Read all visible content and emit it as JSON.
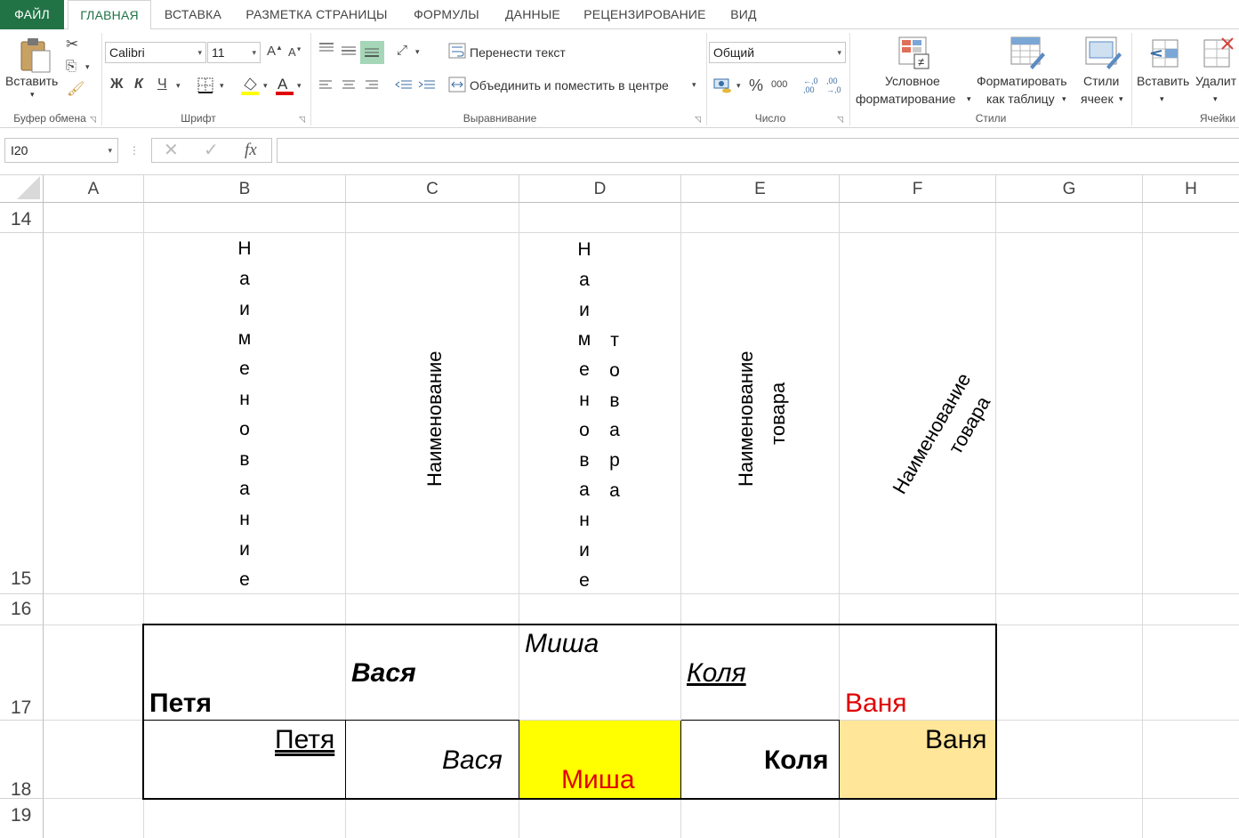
{
  "ribbon_tabs": [
    "ФАЙЛ",
    "ГЛАВНАЯ",
    "ВСТАВКА",
    "РАЗМЕТКА СТРАНИЦЫ",
    "ФОРМУЛЫ",
    "ДАННЫЕ",
    "РЕЦЕНЗИРОВАНИЕ",
    "ВИД"
  ],
  "clipboard": {
    "paste": "Вставить",
    "group": "Буфер обмена"
  },
  "font": {
    "name": "Calibri",
    "size": "11",
    "bold": "Ж",
    "italic": "К",
    "underline": "Ч",
    "group": "Шрифт"
  },
  "alignment": {
    "wrap": "Перенести текст",
    "merge": "Объединить и поместить в центре",
    "group": "Выравнивание"
  },
  "number": {
    "format": "Общий",
    "percent": "%",
    "thousands": "000",
    "group": "Число"
  },
  "styles": {
    "conditional_line1": "Условное",
    "conditional_line2": "форматирование",
    "format_table_line1": "Форматировать",
    "format_table_line2": "как таблицу",
    "cell_styles_line1": "Стили",
    "cell_styles_line2": "ячеек",
    "group": "Стили"
  },
  "cells_group": {
    "insert": "Вставить",
    "delete": "Удалит",
    "group": "Ячейки"
  },
  "formula_bar": {
    "name_box": "I20",
    "formula": ""
  },
  "columns": [
    "A",
    "B",
    "C",
    "D",
    "E",
    "F",
    "G",
    "H"
  ],
  "rows": [
    "14",
    "15",
    "16",
    "17",
    "18",
    "19"
  ],
  "cells": {
    "B15": "Наименование",
    "C15": "Наименование",
    "D15_col1": "Наименование",
    "D15_col2": "товара",
    "E15_line1": "Наименование",
    "E15_line2": "товара",
    "F15_line1": "Наименование",
    "F15_line2": "товара",
    "B17": "Петя",
    "C17": "Вася",
    "D17": "Миша",
    "E17": "Коля",
    "F17": "Ваня",
    "B18": "Петя",
    "C18": "Вася",
    "D18": "Миша",
    "E18": "Коля",
    "F18": "Ваня"
  },
  "colors": {
    "file_tab": "#217346",
    "red_text": "#e00000",
    "yellow_fill": "#ffff00",
    "tan_fill": "#ffe699"
  }
}
